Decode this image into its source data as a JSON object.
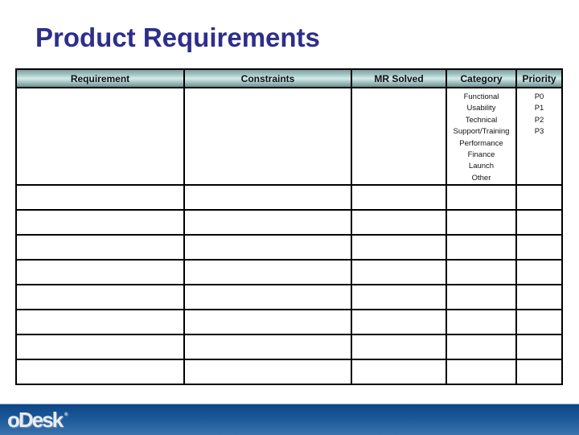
{
  "title": "Product Requirements",
  "table": {
    "headers": [
      "Requirement",
      "Constraints",
      "MR Solved",
      "Category",
      "Priority"
    ],
    "category_options": [
      "Functional",
      "Usability",
      "Technical",
      "Support/Training",
      "Performance",
      "Finance",
      "Launch",
      "Other"
    ],
    "priority_options": [
      "P0",
      "P1",
      "P2",
      "P3"
    ],
    "empty_rows": 8
  },
  "footer": {
    "logo_text": "oDesk",
    "logo_mark": "®",
    "colors": {
      "band": "#1d5a9a",
      "title": "#2e2e8a"
    }
  }
}
